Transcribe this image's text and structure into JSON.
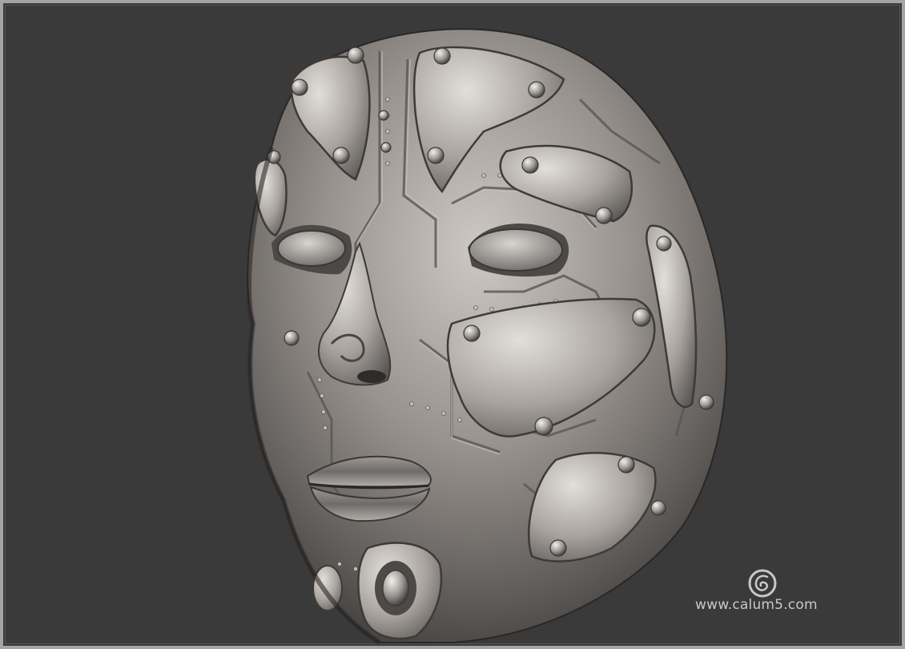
{
  "scene": {
    "subject_icon": "armored-biomech-face-mask",
    "colors": {
      "background": "#3a3a3a",
      "frame": "#a4a4a4",
      "metal_light": "#d2cdc9",
      "metal_mid": "#8e8985",
      "metal_dark": "#3d3a38",
      "watermark_text": "#c8c8c8"
    }
  },
  "watermark": {
    "logo_icon": "calum5-spiral-logo-icon",
    "url_text": "www.calum5.com"
  }
}
